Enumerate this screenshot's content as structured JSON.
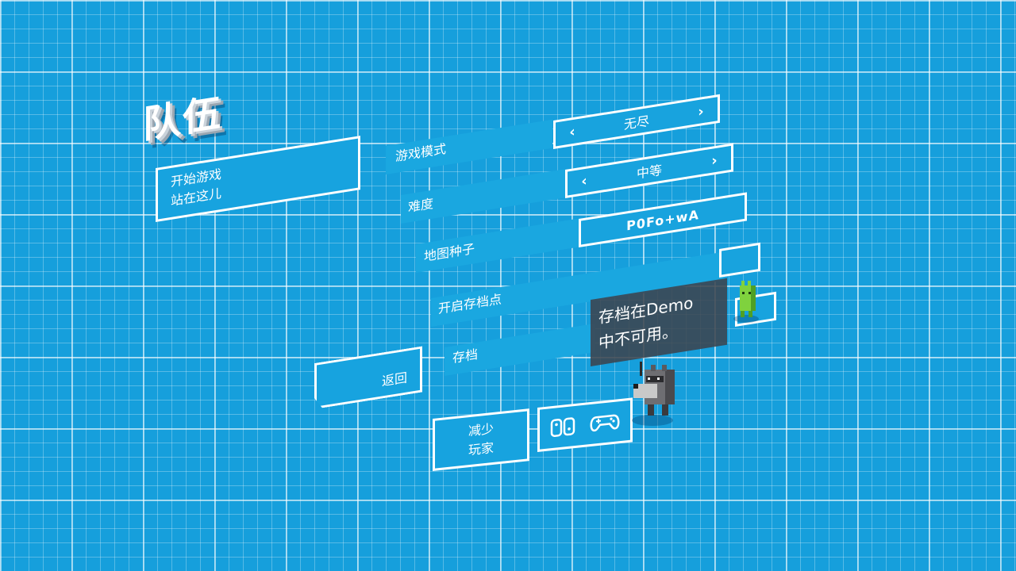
{
  "team": {
    "title": "队伍"
  },
  "start": {
    "line1": "开始游戏",
    "line2": "站在这儿"
  },
  "rows": {
    "mode_label": "游戏模式",
    "mode_value": "无尽",
    "difficulty_label": "难度",
    "difficulty_value": "中等",
    "seed_label": "地图种子",
    "seed_value": "P0Fo+wA",
    "checkpoint_label": "开启存档点",
    "save_label": "存档"
  },
  "buttons": {
    "back": "返回",
    "reduce_line1": "减少",
    "reduce_line2": "玩家"
  },
  "tooltip": {
    "line1": "存档在Demo",
    "line2": "中不可用。"
  },
  "icons": {
    "prev": "chevron-left-icon",
    "next": "chevron-right-icon",
    "controller": "controller-icon"
  },
  "colors": {
    "background": "#169fdc",
    "panel": "#17a3df",
    "border": "#ffffff",
    "tooltip": "#3c444e"
  }
}
